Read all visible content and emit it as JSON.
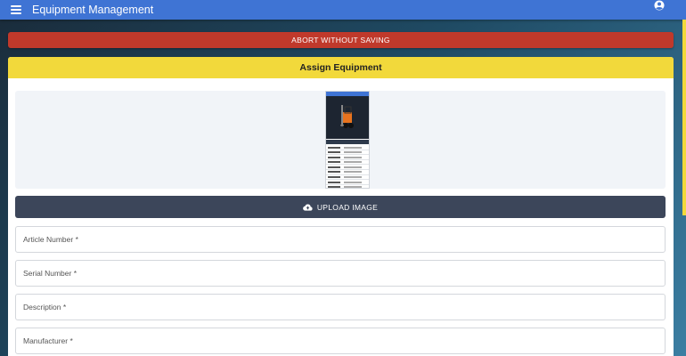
{
  "appbar": {
    "title": "Equipment Management",
    "menu_icon": "hamburger-menu-icon",
    "account_icon": "account-circle-icon"
  },
  "abort_button": {
    "label": "ABORT WITHOUT SAVING",
    "color": "#c0392b"
  },
  "card": {
    "title": "Assign Equipment",
    "header_color": "#f2d93b"
  },
  "upload_button": {
    "label": "UPLOAD IMAGE",
    "icon": "cloud-upload-icon"
  },
  "fields": [
    {
      "label": "Article Number",
      "required_mark": "*"
    },
    {
      "label": "Serial Number",
      "required_mark": "*"
    },
    {
      "label": "Description",
      "required_mark": "*"
    },
    {
      "label": "Manufacturer",
      "required_mark": "*"
    }
  ],
  "colors": {
    "appbar": "#3f74d4",
    "upload": "#3c465a"
  }
}
